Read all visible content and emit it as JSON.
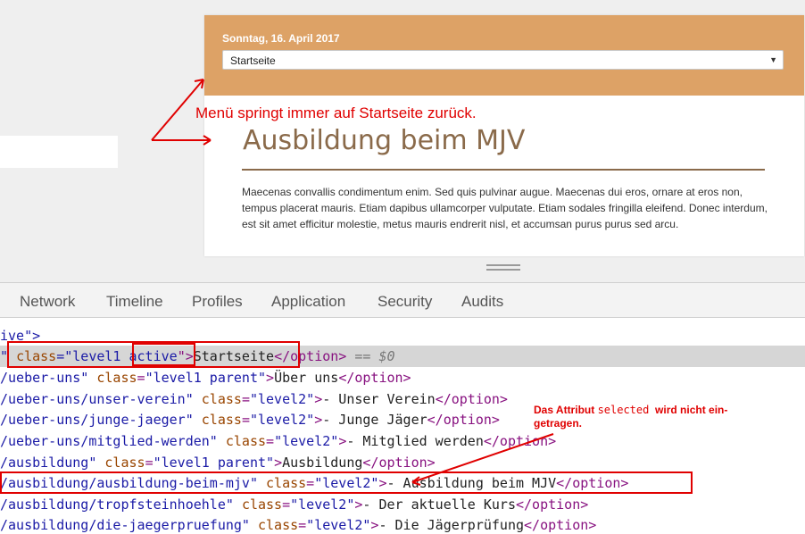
{
  "preview": {
    "date": "Sonntag, 16. April 2017",
    "menu_select": {
      "value": "Startseite",
      "arrow": "▼"
    },
    "heading": "Ausbildung beim MJV",
    "body_text": "Maecenas convallis condimentum enim. Sed quis pulvinar augue. Maecenas dui eros, ornare at eros non, tempus placerat mauris. Etiam dapibus ullamcorper vulputate. Etiam sodales fringilla eleifend. Donec interdum, est sit amet efficitur molestie, metus mauris endrerit nisl, et accumsan purus purus sed arcu."
  },
  "annotations": {
    "menu_note": "Menü springt immer auf Startseite zurück.",
    "selected_note_prefix": "Das Attribut ",
    "selected_note_code": "selected",
    "selected_note_suffix": "  wird nicht ein-",
    "selected_note_line2": "getragen."
  },
  "devtools": {
    "tabs": [
      "Network",
      "Timeline",
      "Profiles",
      "Application",
      "Security",
      "Audits"
    ],
    "lines": [
      {
        "a": "ive\">"
      },
      {
        "q": "\" ",
        "attr": "class",
        "eq": "=\"",
        "v1": "level1 ",
        "v2": "active",
        "close": "\">",
        "text": "Startseite",
        "end": "</option>",
        "cmt": " == $0"
      },
      {
        "path": "/ueber-uns\" ",
        "attr": "class",
        "val": "\"level1 parent\"",
        "gt": ">",
        "text": "Über uns",
        "end": "</option>"
      },
      {
        "path": "/ueber-uns/unser-verein\" ",
        "attr": "class",
        "val": "\"level2\"",
        "gt": ">",
        "text": "- Unser Verein",
        "end": "</option>"
      },
      {
        "path": "/ueber-uns/junge-jaeger\" ",
        "attr": "class",
        "val": "\"level2\"",
        "gt": ">",
        "text": "- Junge Jäger",
        "end": "</option>"
      },
      {
        "path": "/ueber-uns/mitglied-werden\" ",
        "attr": "class",
        "val": "\"level2\"",
        "gt": ">",
        "text": "- Mitglied werden",
        "end": "</option>"
      },
      {
        "path": "/ausbildung\" ",
        "attr": "class",
        "val": "\"level1 parent\"",
        "gt": ">",
        "text": "Ausbildung",
        "end": "</option>"
      },
      {
        "path": "/ausbildung/ausbildung-beim-mjv\" ",
        "attr": "class",
        "val": "\"level2\"",
        "gt": ">",
        "text": "- Ausbildung beim MJV",
        "end": "</option>"
      },
      {
        "path": "/ausbildung/tropfsteinhoehle\" ",
        "attr": "class",
        "val": "\"level2\"",
        "gt": ">",
        "text": "- Der aktuelle Kurs",
        "end": "</option>"
      },
      {
        "path": "/ausbildung/die-jaegerpruefung\" ",
        "attr": "class",
        "val": "\"level2\"",
        "gt": ">",
        "text": "- Die Jägerprüfung",
        "end": "</option>"
      }
    ]
  },
  "colors": {
    "header": "#dda266",
    "annotation": "#e00000",
    "heading": "#8a6a4a"
  }
}
